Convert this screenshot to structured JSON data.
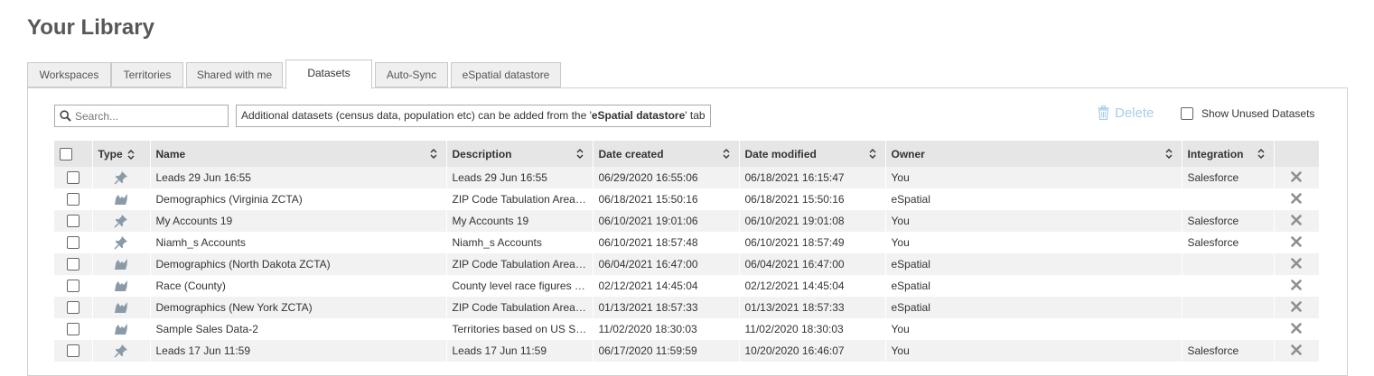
{
  "page": {
    "title": "Your Library"
  },
  "tabs": [
    {
      "label": "Workspaces"
    },
    {
      "label": "Territories"
    },
    {
      "label": "Shared with me"
    },
    {
      "label": "Datasets"
    },
    {
      "label": "Auto-Sync"
    },
    {
      "label": "eSpatial datastore"
    }
  ],
  "toolbar": {
    "search_placeholder": "Search...",
    "info_prefix": "Additional datasets (census data, population etc) can be added from the '",
    "info_link": "eSpatial datastore",
    "info_suffix": "' tab",
    "delete_label": "Delete",
    "show_unused_label": "Show Unused Datasets"
  },
  "columns": {
    "type": "Type",
    "name": "Name",
    "description": "Description",
    "date_created": "Date created",
    "date_modified": "Date modified",
    "owner": "Owner",
    "integration": "Integration"
  },
  "rows": [
    {
      "icon": "pin-icon",
      "name": "Leads 29 Jun 16:55",
      "description": "Leads 29 Jun 16:55",
      "date_created": "06/29/2020 16:55:06",
      "date_modified": "06/18/2021 16:15:47",
      "owner": "You",
      "integration": "Salesforce"
    },
    {
      "icon": "region-icon",
      "name": "Demographics (Virginia ZCTA)",
      "description": "ZIP Code Tabulation Area l…",
      "date_created": "06/18/2021 15:50:16",
      "date_modified": "06/18/2021 15:50:16",
      "owner": "eSpatial",
      "integration": ""
    },
    {
      "icon": "pin-icon",
      "name": "My Accounts 19",
      "description": "My Accounts 19",
      "date_created": "06/10/2021 19:01:06",
      "date_modified": "06/10/2021 19:01:08",
      "owner": "You",
      "integration": "Salesforce"
    },
    {
      "icon": "pin-icon",
      "name": "Niamh_s Accounts",
      "description": "Niamh_s Accounts",
      "date_created": "06/10/2021 18:57:48",
      "date_modified": "06/10/2021 18:57:49",
      "owner": "You",
      "integration": "Salesforce"
    },
    {
      "icon": "region-icon",
      "name": "Demographics (North Dakota ZCTA)",
      "description": "ZIP Code Tabulation Area l…",
      "date_created": "06/04/2021 16:47:00",
      "date_modified": "06/04/2021 16:47:00",
      "owner": "eSpatial",
      "integration": ""
    },
    {
      "icon": "region-icon",
      "name": "Race (County)",
      "description": "County level race figures fr…",
      "date_created": "02/12/2021 14:45:04",
      "date_modified": "02/12/2021 14:45:04",
      "owner": "eSpatial",
      "integration": ""
    },
    {
      "icon": "region-icon",
      "name": "Demographics (New York ZCTA)",
      "description": "ZIP Code Tabulation Area l…",
      "date_created": "01/13/2021 18:57:33",
      "date_modified": "01/13/2021 18:57:33",
      "owner": "eSpatial",
      "integration": ""
    },
    {
      "icon": "region-icon",
      "name": "Sample Sales Data-2",
      "description": "Territories based on US St…",
      "date_created": "11/02/2020 18:30:03",
      "date_modified": "11/02/2020 18:30:03",
      "owner": "You",
      "integration": ""
    },
    {
      "icon": "pin-icon",
      "name": "Leads 17 Jun 11:59",
      "description": "Leads 17 Jun 11:59",
      "date_created": "06/17/2020 11:59:59",
      "date_modified": "10/20/2020 16:46:07",
      "owner": "You",
      "integration": "Salesforce"
    }
  ],
  "colors": {
    "delete_disabled": "#a8cde8",
    "header_bg": "#e6e6e6",
    "stripe_bg": "#f2f2f2",
    "remove_icon": "#8f8f8f",
    "type_icon": "#8a9aa6"
  }
}
